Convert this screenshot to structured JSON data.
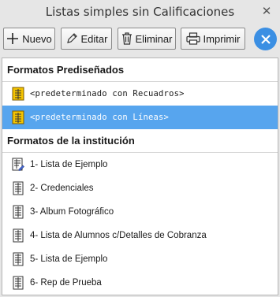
{
  "window": {
    "title": "Listas simples sin Calificaciones"
  },
  "toolbar": {
    "nuevo_label": "Nuevo",
    "editar_label": "Editar",
    "eliminar_label": "Eliminar",
    "imprimir_label": "Imprimir"
  },
  "sections": {
    "predisenados": {
      "title": "Formatos Prediseñados",
      "items": [
        {
          "label": "<predeterminado con Recuadros>"
        },
        {
          "label": "<predeterminado con Líneas>"
        }
      ]
    },
    "institucion": {
      "title": "Formatos de la institución",
      "items": [
        {
          "label": "1-  Lista de Ejemplo"
        },
        {
          "label": "2- Credenciales"
        },
        {
          "label": "3- Album Fotográfico"
        },
        {
          "label": "4- Lista de Alumnos c/Detalles de Cobranza"
        },
        {
          "label": "5- Lista de Ejemplo"
        },
        {
          "label": "6- Rep de Prueba"
        }
      ]
    }
  },
  "colors": {
    "accent": "#3b8fe3",
    "selection": "#57a5ee",
    "predef_icon": "#d8a400"
  },
  "icons": [
    "close-icon",
    "plus-icon",
    "pencil-icon",
    "trash-icon",
    "printer-icon",
    "close-circle-icon",
    "list-document-icon",
    "list-edit-icon"
  ]
}
